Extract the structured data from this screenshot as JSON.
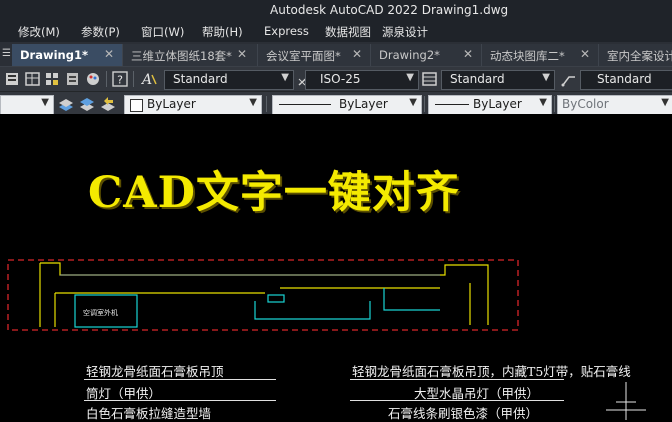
{
  "window": {
    "title": "Autodesk AutoCAD 2022    Drawing1.dwg"
  },
  "menu": {
    "items": [
      "修改(M)",
      "参数(P)",
      "窗口(W)",
      "帮助(H)",
      "Express",
      "数据视图",
      "源泉设计"
    ]
  },
  "tabs": [
    {
      "label": "Drawing1*",
      "active": true
    },
    {
      "label": "三维立体图纸18套*",
      "active": false
    },
    {
      "label": "会议室平面图*",
      "active": false
    },
    {
      "label": "Drawing2*",
      "active": false
    },
    {
      "label": "动态块图库二*",
      "active": false
    },
    {
      "label": "室内全案设计",
      "active": false
    }
  ],
  "toolbar1": {
    "text_style": "Standard",
    "dim_style": "ISO-25",
    "table_style": "Standard",
    "mleader_style": "Standard"
  },
  "toolbar2": {
    "color": "ByLayer",
    "linetype": "ByLayer",
    "lineweight": "ByLayer",
    "plotstyle": "ByColor"
  },
  "drawing": {
    "headline": "CAD文字一键对齐",
    "room_label": "空调室外机",
    "annotations_left": [
      "轻钢龙骨纸面石膏板吊顶",
      "筒灯（甲供）",
      "白色石膏板拉缝造型墙"
    ],
    "annotations_right": [
      "轻钢龙骨纸面石膏板吊顶，内藏T5灯带，贴石膏线",
      "大型水晶吊灯（甲供）",
      "石膏线条刷银色漆（甲供）"
    ]
  },
  "colors": {
    "headline": "#f4ea00",
    "red_dash": "#d8262a",
    "cyan": "#19d4d4",
    "yellow_line": "#e8e000",
    "tab_active": "#3a4c63"
  }
}
